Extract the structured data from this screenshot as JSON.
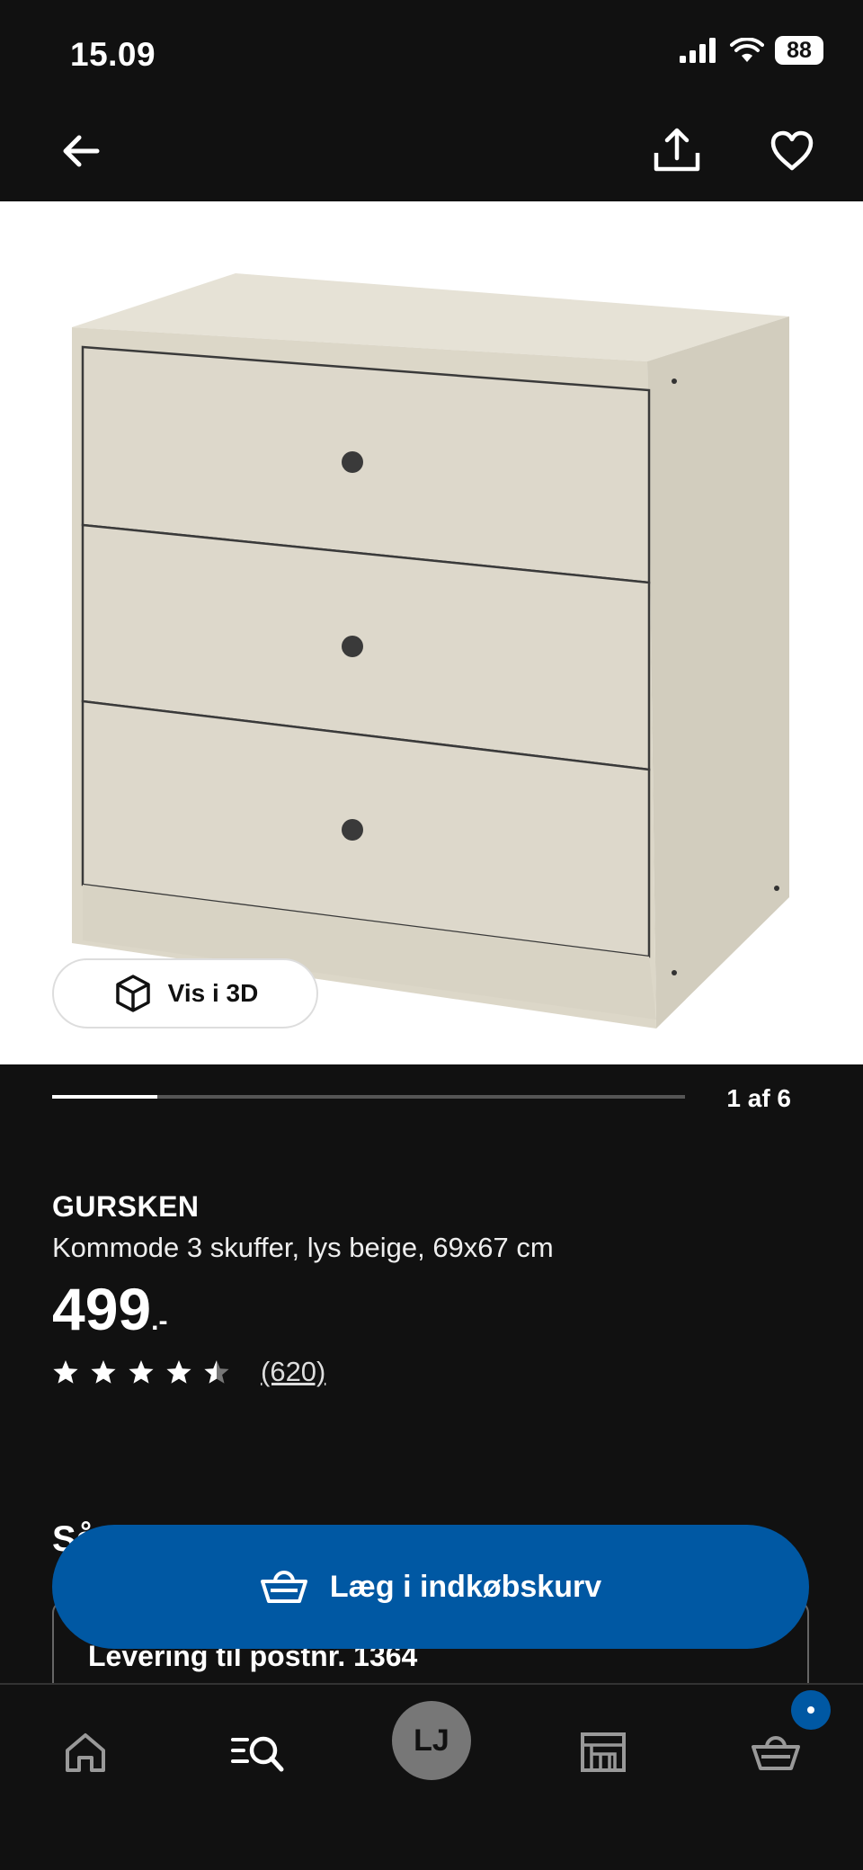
{
  "status_bar": {
    "time": "15.09",
    "battery": "88"
  },
  "product": {
    "image_alt": "GURSKEN chest of drawers",
    "view_3d_label": "Vis i 3D",
    "image_counter": "1 af 6",
    "image_progress": 0.1667,
    "brand": "GURSKEN",
    "description": "Kommode 3 skuffer, lys beige, 69x67 cm",
    "price": "499",
    "price_suffix": ".-",
    "rating": 4.5,
    "rating_count": "(620)"
  },
  "section_peek": "Så",
  "delivery": {
    "label": "Levering til postnr. 1364"
  },
  "cart_button": {
    "label": "Læg i indkøbskurv"
  },
  "tabbar": {
    "avatar_initials": "LJ"
  },
  "colors": {
    "accent": "#0058A3",
    "background": "#111111",
    "furniture": "#DDD8CB"
  }
}
